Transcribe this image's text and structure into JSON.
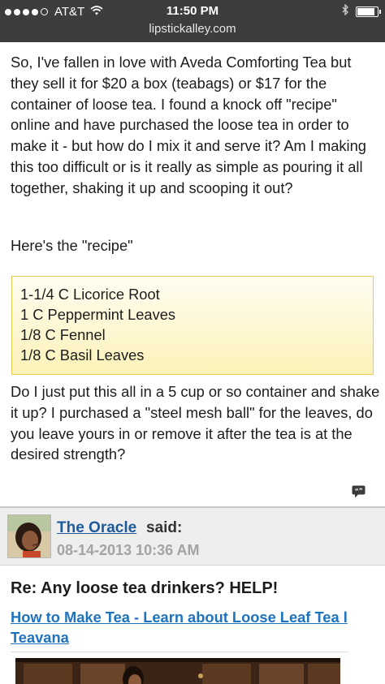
{
  "status_bar": {
    "carrier": "AT&T",
    "time": "11:50 PM",
    "url": "lipstickalley.com",
    "signal_dots_filled": 4,
    "signal_dots_total": 5,
    "battery_level": 0.95
  },
  "post": {
    "paragraph1": "So, I've fallen in love with Aveda Comforting Tea but they sell it for $20 a box (teabags) or $17 for the container of loose tea. I found a knock off \"recipe\" online and have purchased the loose tea in order to make it - but how do I mix it and serve it? Am I making this too difficult or is it really as simple as pouring it all together, shaking it up and scooping it out?",
    "recipe_label": "Here's the \"recipe\"",
    "recipe": [
      "1-1/4 C Licorice Root",
      "1 C Peppermint Leaves",
      "1/8 C Fennel",
      "1/8 C Basil Leaves"
    ],
    "paragraph2": "Do I just put this all in a 5 cup or so container and shake it up? I purchased a \"steel mesh ball\" for the leaves, do you leave yours in or remove it after the tea is at the desired strength?"
  },
  "reply": {
    "author": "The Oracle",
    "said": "said:",
    "date": "08-14-2013 10:36 AM",
    "title": "Re: Any loose tea drinkers? HELP!",
    "link_text": "How to Make Tea - Learn about Loose Leaf Tea l Teavana"
  },
  "colors": {
    "status_bar_bg": "#3d3d3d",
    "link": "#1e73be",
    "author_link": "#1e5a9a",
    "date_gray": "#a3a3a3",
    "recipe_border": "#e7cb52"
  },
  "icons": {
    "quote": "quote-bubble-icon",
    "wifi": "wifi-icon",
    "bluetooth": "bluetooth-icon"
  }
}
